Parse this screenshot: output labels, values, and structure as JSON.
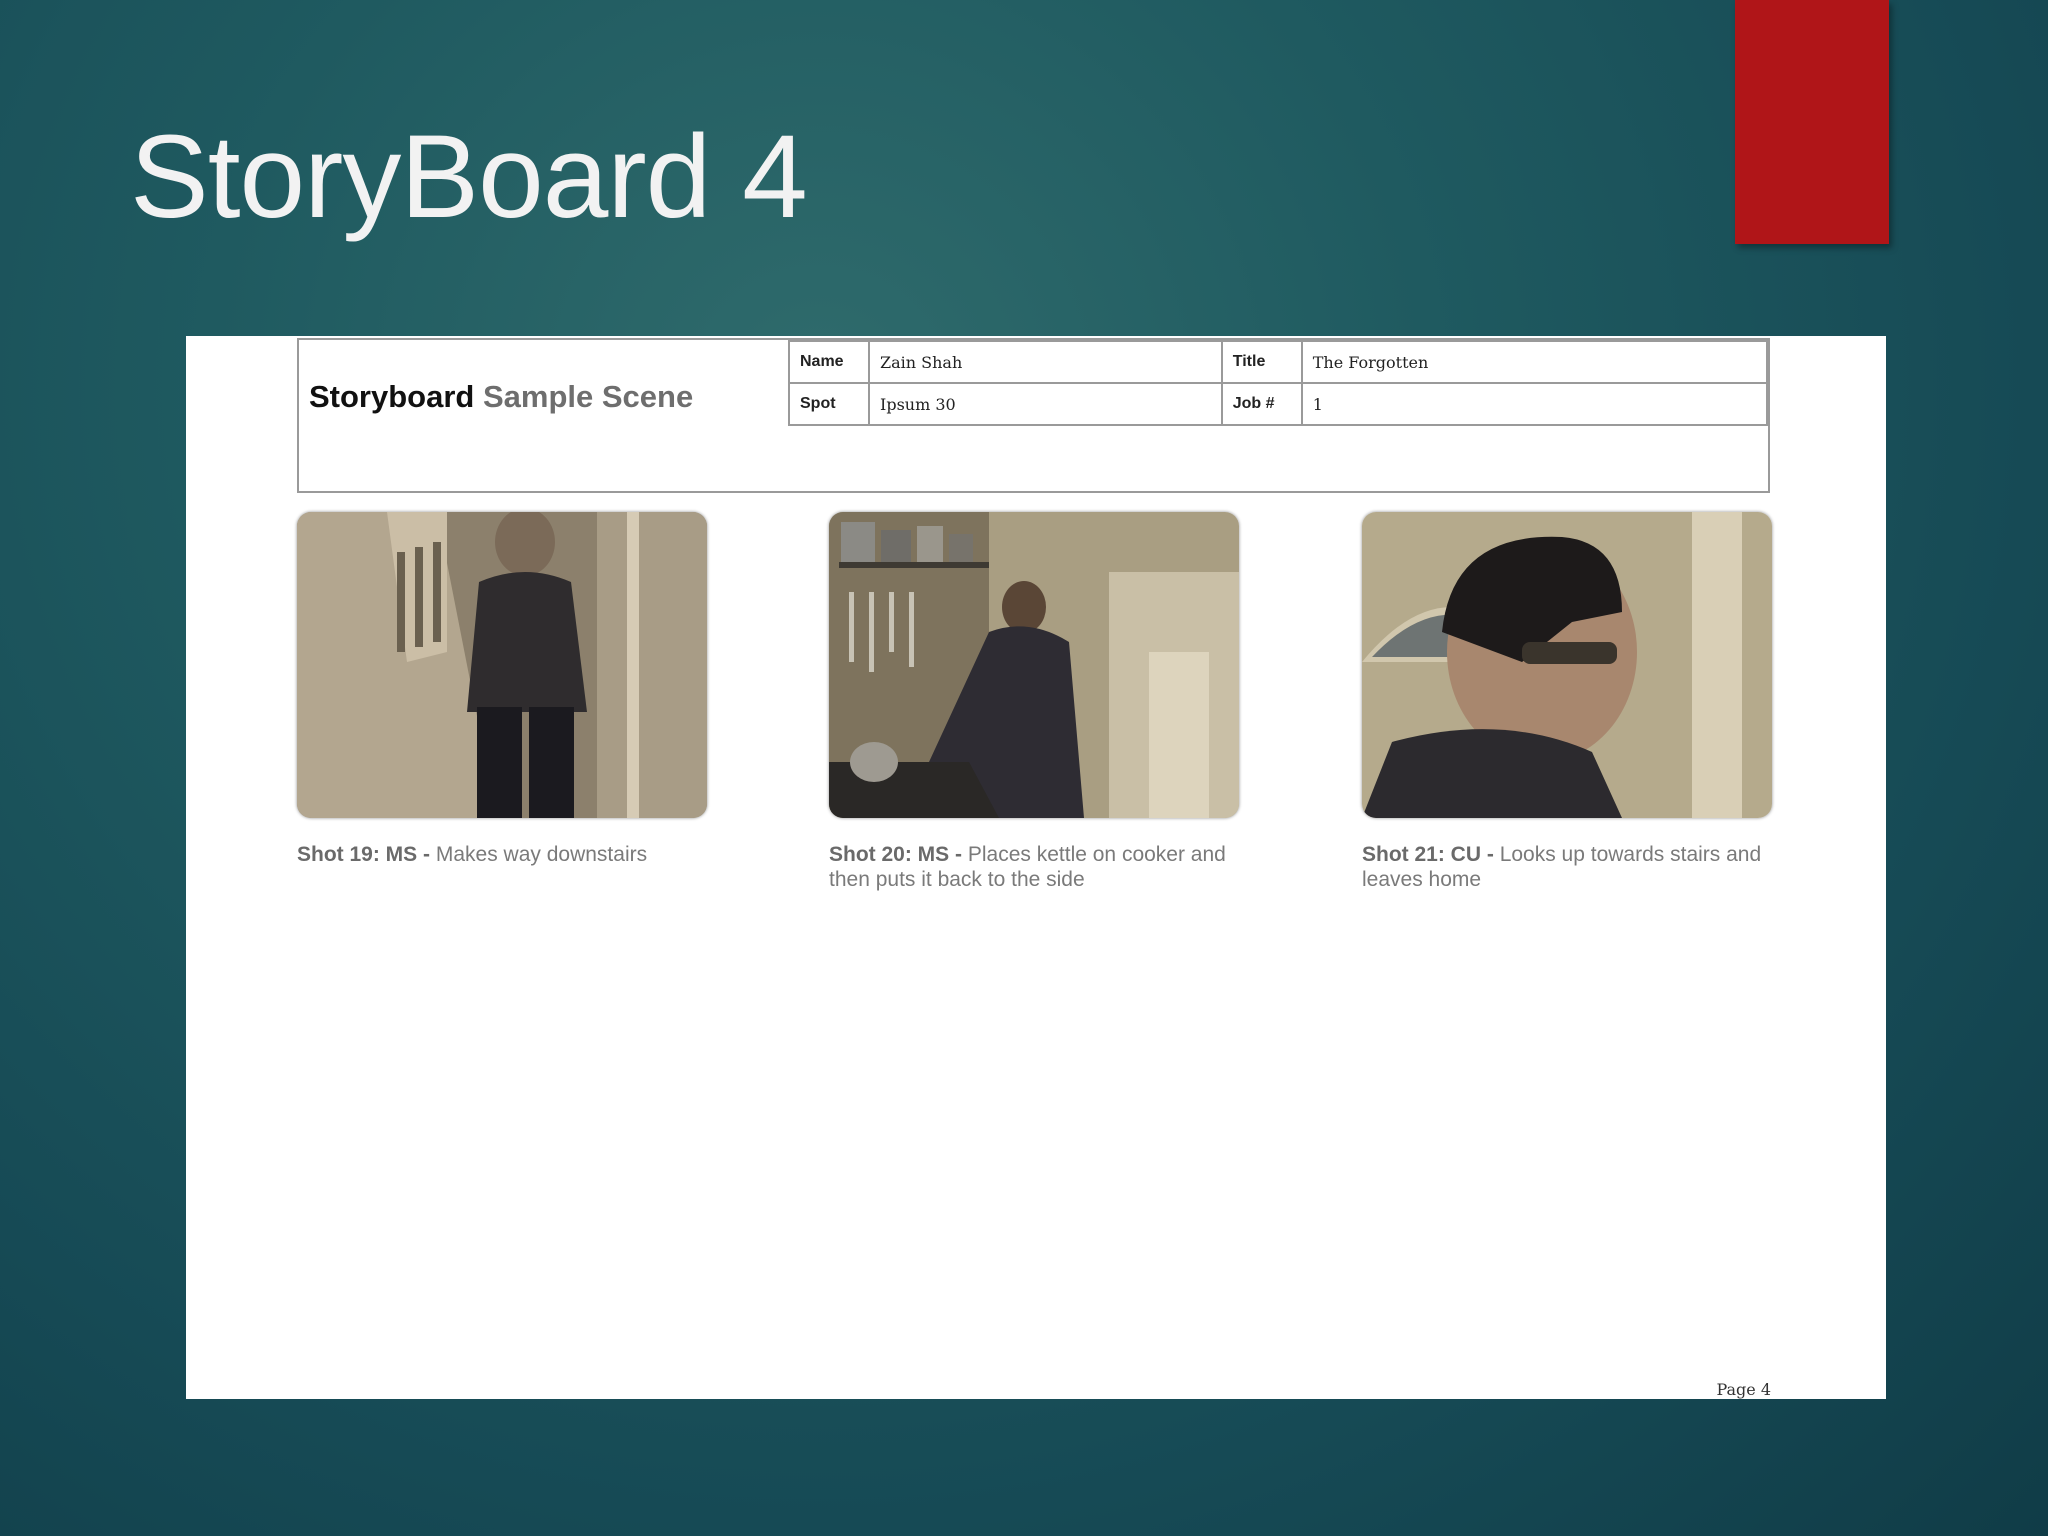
{
  "slide": {
    "title": "StoryBoard 4",
    "accent_color": "#b01518"
  },
  "document": {
    "heading_bold": "Storyboard",
    "heading_sub": "Sample Scene",
    "fields": {
      "name_label": "Name",
      "name_value": "Zain Shah",
      "title_label": "Title",
      "title_value": "The Forgotten",
      "spot_label": "Spot",
      "spot_value": "Ipsum 30",
      "job_label": "Job #",
      "job_value": "1"
    },
    "shots": [
      {
        "code": "Shot 19: MS -",
        "description": "Makes way downstairs"
      },
      {
        "code": "Shot 20: MS -",
        "description": "Places kettle on cooker and then puts it back to the side"
      },
      {
        "code": "Shot 21: CU -",
        "description": "Looks up towards stairs and leaves home"
      }
    ],
    "page_label": "Page 4"
  }
}
